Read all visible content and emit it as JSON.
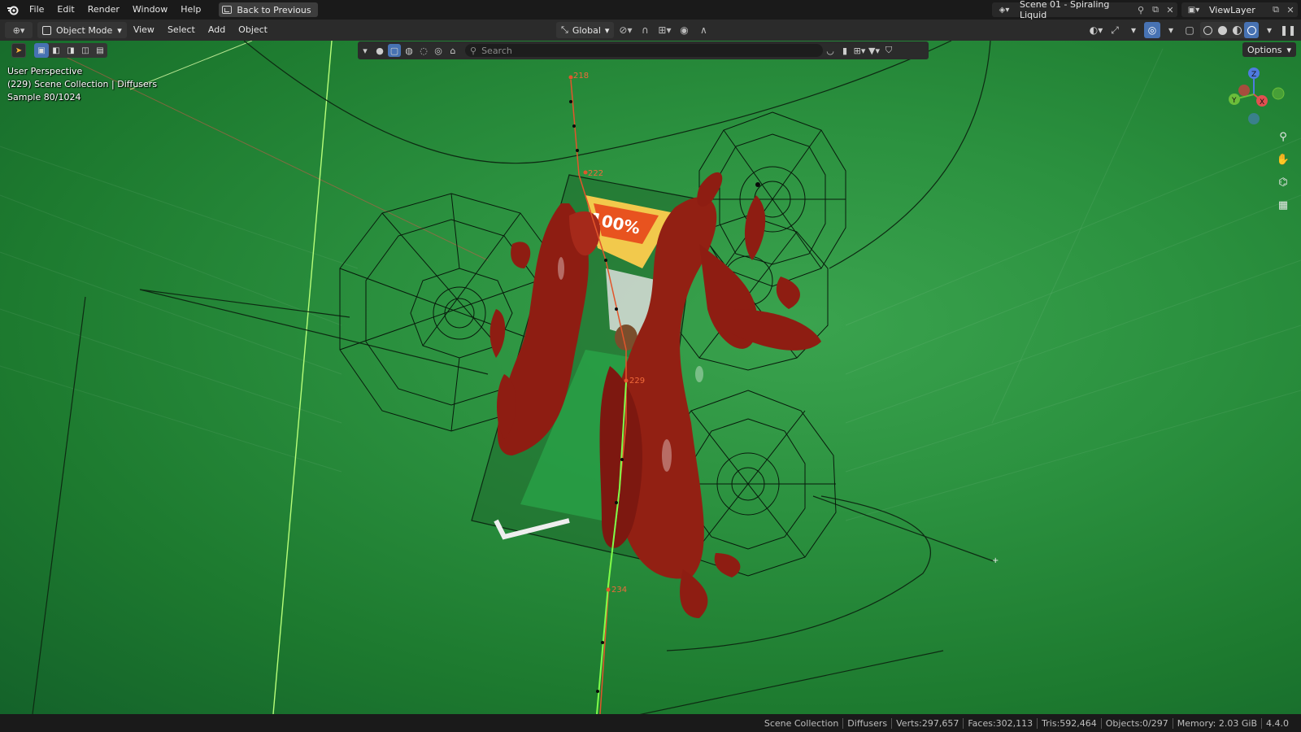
{
  "topbar": {
    "menus": [
      "File",
      "Edit",
      "Render",
      "Window",
      "Help"
    ],
    "back_button": "Back to Previous",
    "scene_name": "Scene 01 - Spiraling Liquid",
    "view_layer": "ViewLayer"
  },
  "header": {
    "mode": "Object Mode",
    "menus": [
      "View",
      "Select",
      "Add",
      "Object"
    ],
    "orientation": "Global"
  },
  "outliner": {
    "search_placeholder": "Search"
  },
  "viewport": {
    "options_label": "Options",
    "info_line1": "User Perspective",
    "info_line2": "(229) Scene Collection | Diffusers",
    "info_line3": "Sample 80/1024",
    "frame_markers": [
      "218",
      "222",
      "229",
      "234"
    ],
    "gizmo_axes": [
      "Z",
      "Y",
      "X"
    ],
    "label_text": "100%"
  },
  "status": {
    "items": [
      "Scene Collection",
      "Diffusers",
      "Verts:297,657",
      "Faces:302,113",
      "Tris:592,464",
      "Objects:0/297",
      "Memory: 2.03 GiB",
      "4.4.0"
    ]
  },
  "colors": {
    "accent": "#4772b3",
    "green_screen": "#2b913f",
    "liquid": "#8e1d12"
  }
}
